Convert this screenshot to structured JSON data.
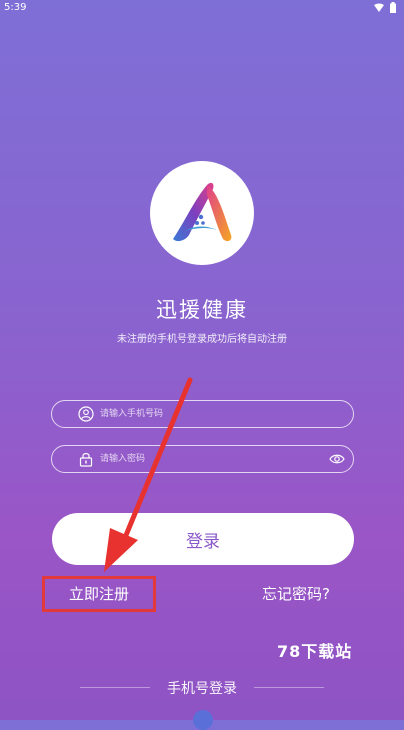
{
  "status": {
    "time": "5:39"
  },
  "app": {
    "name": "迅援健康",
    "subtitle": "未注册的手机号登录成功后将自动注册"
  },
  "form": {
    "phone_placeholder": "请输入手机号码",
    "password_placeholder": "请输入密码",
    "login_label": "登录",
    "register_label": "立即注册",
    "forgot_label": "忘记密码?"
  },
  "watermark": "78下载站",
  "alt_login": {
    "label": "手机号登录"
  },
  "colors": {
    "accent": "#8a59c9",
    "highlight_border": "#e23a3a",
    "arrow": "#e8322f"
  },
  "icons": [
    "wifi-icon",
    "battery-icon",
    "user-icon",
    "lock-icon",
    "eye-icon",
    "app-logo"
  ]
}
